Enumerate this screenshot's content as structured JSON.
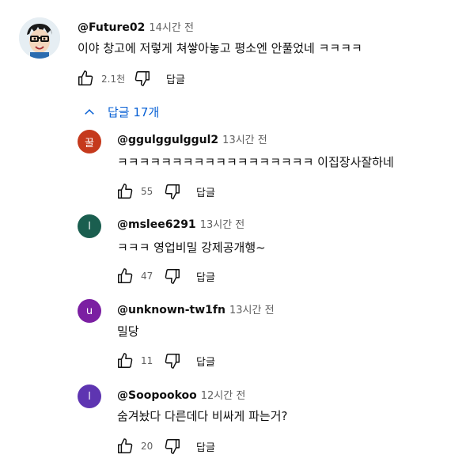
{
  "main_comment": {
    "handle": "@Future02",
    "time": "14시간 전",
    "text": "이야 창고에 저렇게 쳐쌓아놓고 평소엔 안풀었네 ㅋㅋㅋㅋ",
    "likes": "2.1천",
    "reply_label": "답글"
  },
  "replies_toggle": {
    "label": "답글 17개",
    "icon": "chevron-up-icon",
    "color": "#065fd4"
  },
  "replies": [
    {
      "avatar_letter": "꿀",
      "avatar_color": "#c5391c",
      "handle": "@ggulggulggul2",
      "time": "13시간 전",
      "text": "ㅋㅋㅋㅋㅋㅋㅋㅋㅋㅋㅋㅋㅋㅋㅋㅋㅋㅋ 이집장사잘하네",
      "likes": "55",
      "reply_label": "답글"
    },
    {
      "avatar_letter": "l",
      "avatar_color": "#1a5e4f",
      "handle": "@mslee6291",
      "time": "13시간 전",
      "text": "ㅋㅋㅋ 영업비밀 강제공개행~",
      "likes": "47",
      "reply_label": "답글"
    },
    {
      "avatar_letter": "u",
      "avatar_color": "#7b1fa2",
      "handle": "@unknown-tw1fn",
      "time": "13시간 전",
      "text": "밀당",
      "likes": "11",
      "reply_label": "답글"
    },
    {
      "avatar_letter": "l",
      "avatar_color": "#5e35b1",
      "handle": "@Soopookoo",
      "time": "12시간 전",
      "text": "숨겨놨다 다른데다 비싸게 파는거?",
      "likes": "20",
      "reply_label": "답글"
    }
  ]
}
